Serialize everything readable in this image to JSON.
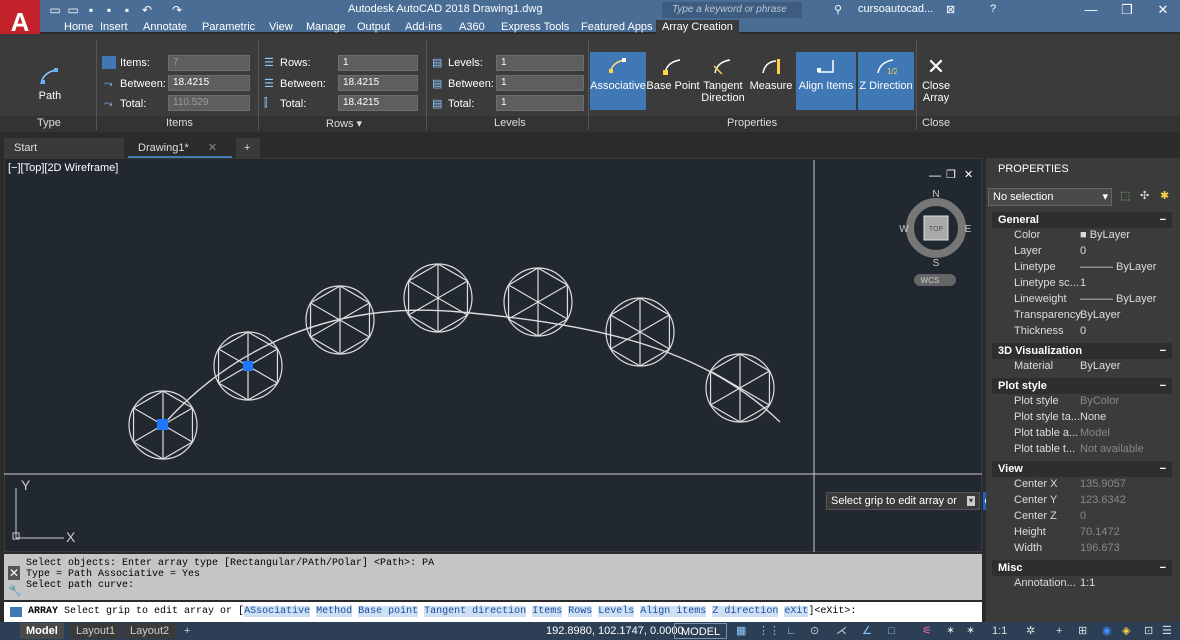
{
  "window": {
    "title": "Autodesk AutoCAD 2018   Drawing1.dwg",
    "search_placeholder": "Type a keyword or phrase",
    "user": "cursoautocad...",
    "min": "—",
    "max": "❐",
    "close": "✕"
  },
  "menu_tabs": [
    "Home",
    "Insert",
    "Annotate",
    "Parametric",
    "View",
    "Manage",
    "Output",
    "Add-ins",
    "A360",
    "Express Tools",
    "Featured Apps",
    "Array Creation"
  ],
  "ribbon": {
    "type": {
      "button": "Path",
      "panel": "Type"
    },
    "items": {
      "items_label": "Items:",
      "items_value": "7",
      "between_label": "Between:",
      "between_value": "18.4215",
      "total_label": "Total:",
      "total_value": "110.529",
      "panel": "Items"
    },
    "rows": {
      "rows_label": "Rows:",
      "rows_value": "1",
      "between_label": "Between:",
      "between_value": "18.4215",
      "total_label": "Total:",
      "total_value": "18.4215",
      "panel": "Rows ▾"
    },
    "levels": {
      "levels_label": "Levels:",
      "levels_value": "1",
      "between_label": "Between:",
      "between_value": "1",
      "total_label": "Total:",
      "total_value": "1",
      "panel": "Levels"
    },
    "properties": {
      "associative": "Associative",
      "base_point": "Base Point",
      "tangent": "Tangent",
      "direction": "Direction",
      "measure": "Measure",
      "align_items": "Align Items",
      "z_direction": "Z Direction",
      "panel": "Properties"
    },
    "close": {
      "line1": "Close",
      "line2": "Array",
      "panel": "Close"
    }
  },
  "doc_tabs": {
    "start": "Start",
    "drawing": "Drawing1*",
    "close": "✕",
    "add": "+"
  },
  "viewport": {
    "label": "[−][Top][2D Wireframe]",
    "viewcube": {
      "n": "N",
      "s": "S",
      "e": "E",
      "w": "W",
      "top": "TOP",
      "wcs": "WCS"
    },
    "ucs": {
      "x": "X",
      "y": "Y"
    },
    "tooltip": "Select grip to edit array or",
    "exit_option": "eXit",
    "controls": {
      "min": "—",
      "restore": "❐",
      "close": "✕"
    }
  },
  "properties": {
    "title": "PROPERTIES",
    "selection": "No selection",
    "sections": [
      {
        "name": "General",
        "rows": [
          [
            "Color",
            "■ ByLayer"
          ],
          [
            "Layer",
            "0"
          ],
          [
            "Linetype",
            "——— ByLayer"
          ],
          [
            "Linetype sc...",
            "1"
          ],
          [
            "Lineweight",
            "——— ByLayer"
          ],
          [
            "Transparency",
            "ByLayer"
          ],
          [
            "Thickness",
            "0"
          ]
        ]
      },
      {
        "name": "3D Visualization",
        "rows": [
          [
            "Material",
            "ByLayer"
          ]
        ]
      },
      {
        "name": "Plot style",
        "rows": [
          [
            "Plot style",
            "ByColor"
          ],
          [
            "Plot style ta...",
            "None"
          ],
          [
            "Plot table a...",
            "Model"
          ],
          [
            "Plot table t...",
            "Not available"
          ]
        ]
      },
      {
        "name": "View",
        "rows": [
          [
            "Center X",
            "135.9057"
          ],
          [
            "Center Y",
            "123.6342"
          ],
          [
            "Center Z",
            "0"
          ],
          [
            "Height",
            "70.1472"
          ],
          [
            "Width",
            "196.673"
          ]
        ]
      },
      {
        "name": "Misc",
        "rows": [
          [
            "Annotation...",
            "1:1"
          ]
        ]
      }
    ]
  },
  "command": {
    "history": [
      "Select objects:  Enter array type [Rectangular/PAth/POlar] <Path>: PA",
      "Type = Path  Associative = Yes",
      "Select path curve:"
    ],
    "prompt_cmd": "ARRAY",
    "prompt_text": "Select grip to edit array or [",
    "options": [
      "ASsociative",
      "Method",
      "Base point",
      "Tangent direction",
      "Items",
      "Rows",
      "Levels",
      "Align items",
      "Z direction",
      "eXit"
    ],
    "prompt_end": "]<eXit>:"
  },
  "status": {
    "layout_tabs": [
      "Model",
      "Layout1",
      "Layout2",
      "+"
    ],
    "coords": "192.8980, 102.1747, 0.0000",
    "space": "MODEL"
  },
  "colors": {
    "grip": "#1e78ff",
    "title_bar": "#4a6d95",
    "highlight": "#3f78b5"
  }
}
